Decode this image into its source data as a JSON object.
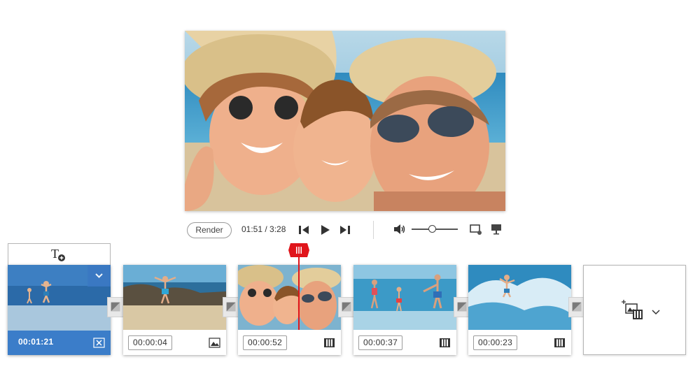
{
  "controls": {
    "render_label": "Render",
    "timecode": "01:51 / 3:28",
    "volume_level": 0.45
  },
  "timeline": {
    "clips": [
      {
        "duration": "00:01:21",
        "type": "title-clip",
        "selected": true
      },
      {
        "duration": "00:00:04",
        "type": "image"
      },
      {
        "duration": "00:00:52",
        "type": "video"
      },
      {
        "duration": "00:00:37",
        "type": "video"
      },
      {
        "duration": "00:00:23",
        "type": "video"
      }
    ],
    "playhead_icon": "playhead-marker-icon",
    "add_media_icon": "add-media-icon"
  },
  "colors": {
    "accent": "#3b7dc9",
    "playhead": "#e0151b",
    "text": "#333333"
  }
}
